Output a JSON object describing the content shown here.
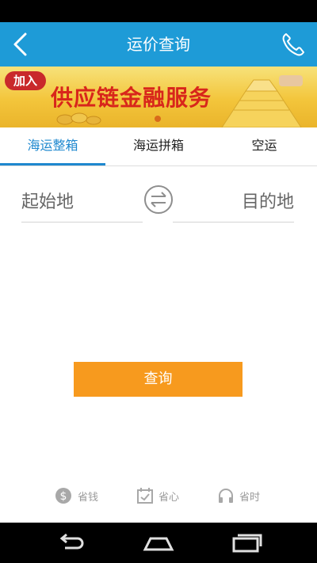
{
  "header": {
    "title": "运价查询",
    "back_icon": "back-arrow-icon",
    "phone_icon": "phone-icon"
  },
  "banner": {
    "badge": "加入",
    "title": "供应链金融服务"
  },
  "tabs": [
    {
      "label": "海运整箱",
      "active": true
    },
    {
      "label": "海运拼箱",
      "active": false
    },
    {
      "label": "空运",
      "active": false
    }
  ],
  "route": {
    "origin_placeholder": "起始地",
    "destination_placeholder": "目的地",
    "swap_icon": "swap-arrows-icon"
  },
  "query_button": "查询",
  "features": [
    {
      "icon": "dollar-coin-icon",
      "label": "省钱"
    },
    {
      "icon": "calendar-check-icon",
      "label": "省心"
    },
    {
      "icon": "headphones-icon",
      "label": "省时"
    }
  ],
  "colors": {
    "header": "#1e9bd7",
    "accent": "#1e88cf",
    "button": "#f79a1e"
  }
}
